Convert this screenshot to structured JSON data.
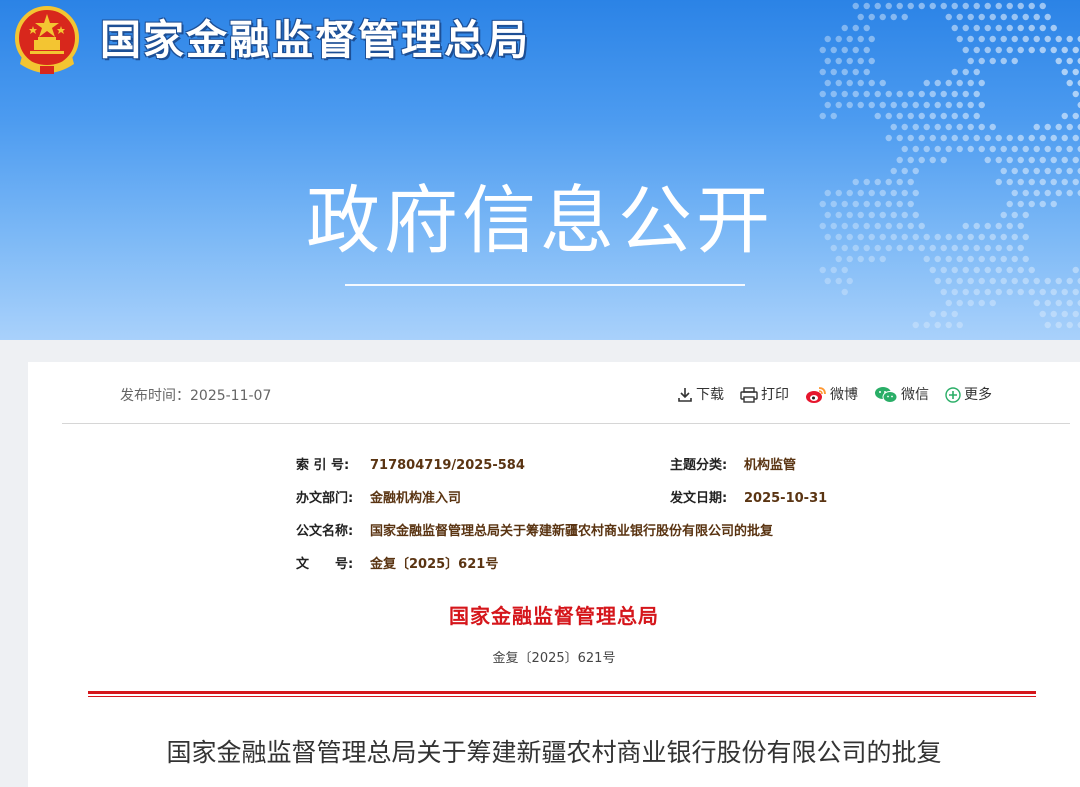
{
  "header": {
    "org_name": "国家金融监督管理总局",
    "section_title": "政府信息公开"
  },
  "toolbar": {
    "publish_label": "发布时间：",
    "publish_date": "2025-11-07",
    "download": "下载",
    "print": "打印",
    "weibo": "微博",
    "wechat": "微信",
    "more": "更多"
  },
  "meta": {
    "index_label": "索 引 号:",
    "index_value": "717804719/2025-584",
    "topic_label": "主题分类:",
    "topic_value": "机构监管",
    "dept_label": "办文部门:",
    "dept_value": "金融机构准入司",
    "date_label": "发文日期:",
    "date_value": "2025-10-31",
    "name_label": "公文名称:",
    "name_value": "国家金融监督管理总局关于筹建新疆农村商业银行股份有限公司的批复",
    "docno_label": "文　　号:",
    "docno_value": "金复〔2025〕621号"
  },
  "document": {
    "issuer": "国家金融监督管理总局",
    "doc_number": "金复〔2025〕621号",
    "title": "国家金融监督管理总局关于筹建新疆农村商业银行股份有限公司的批复"
  },
  "colors": {
    "banner_top": "#2b83e6",
    "banner_bottom": "#a9d1fb",
    "red_accent": "#d5161b",
    "meta_value": "#5a3412"
  }
}
